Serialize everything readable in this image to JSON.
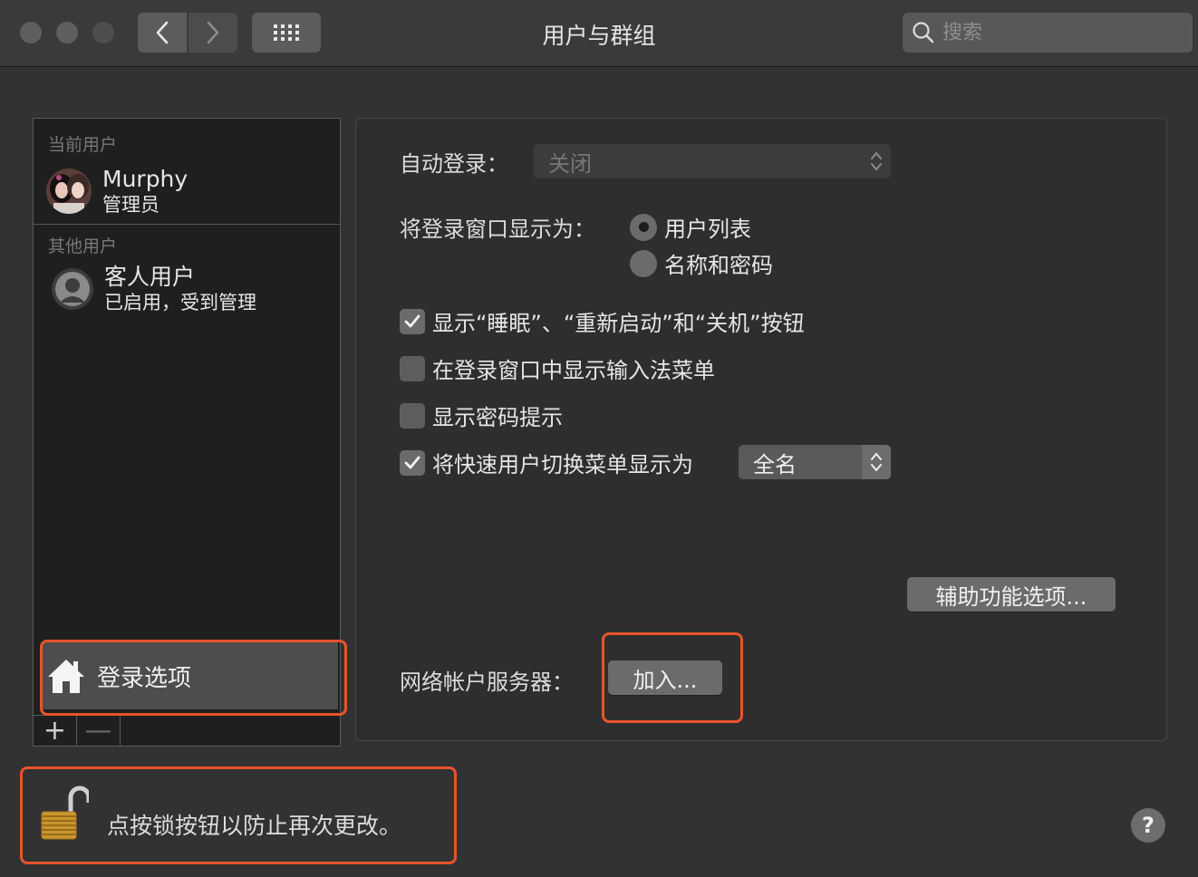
{
  "window": {
    "title": "用户与群组"
  },
  "toolbar": {
    "search_placeholder": "搜索"
  },
  "sidebar": {
    "current_label": "当前用户",
    "current_user": {
      "name": "Murphy",
      "role": "管理员"
    },
    "other_label": "其他用户",
    "other_user": {
      "name": "客人用户",
      "status": "已启用，受到管理"
    },
    "login_options": "登录选项",
    "add": "+",
    "remove": "—"
  },
  "panel": {
    "auto_login_label": "自动登录：",
    "auto_login_value": "关闭",
    "display_label": "将登录窗口显示为：",
    "radio_options": [
      "用户列表",
      "名称和密码"
    ],
    "radio_selected": 0,
    "checks": [
      {
        "label": "显示“睡眠”、“重新启动”和“关机”按钮",
        "checked": true
      },
      {
        "label": "在登录窗口中显示输入法菜单",
        "checked": false
      },
      {
        "label": "显示密码提示",
        "checked": false
      },
      {
        "label": "将快速用户切换菜单显示为",
        "checked": true
      }
    ],
    "fast_switch_value": "全名",
    "accessibility_button": "辅助功能选项...",
    "network_label": "网络帐户服务器：",
    "join_button": "加入..."
  },
  "footer": {
    "lock_text": "点按锁按钮以防止再次更改。",
    "help": "?"
  },
  "colors": {
    "highlight": "#e8532a"
  }
}
